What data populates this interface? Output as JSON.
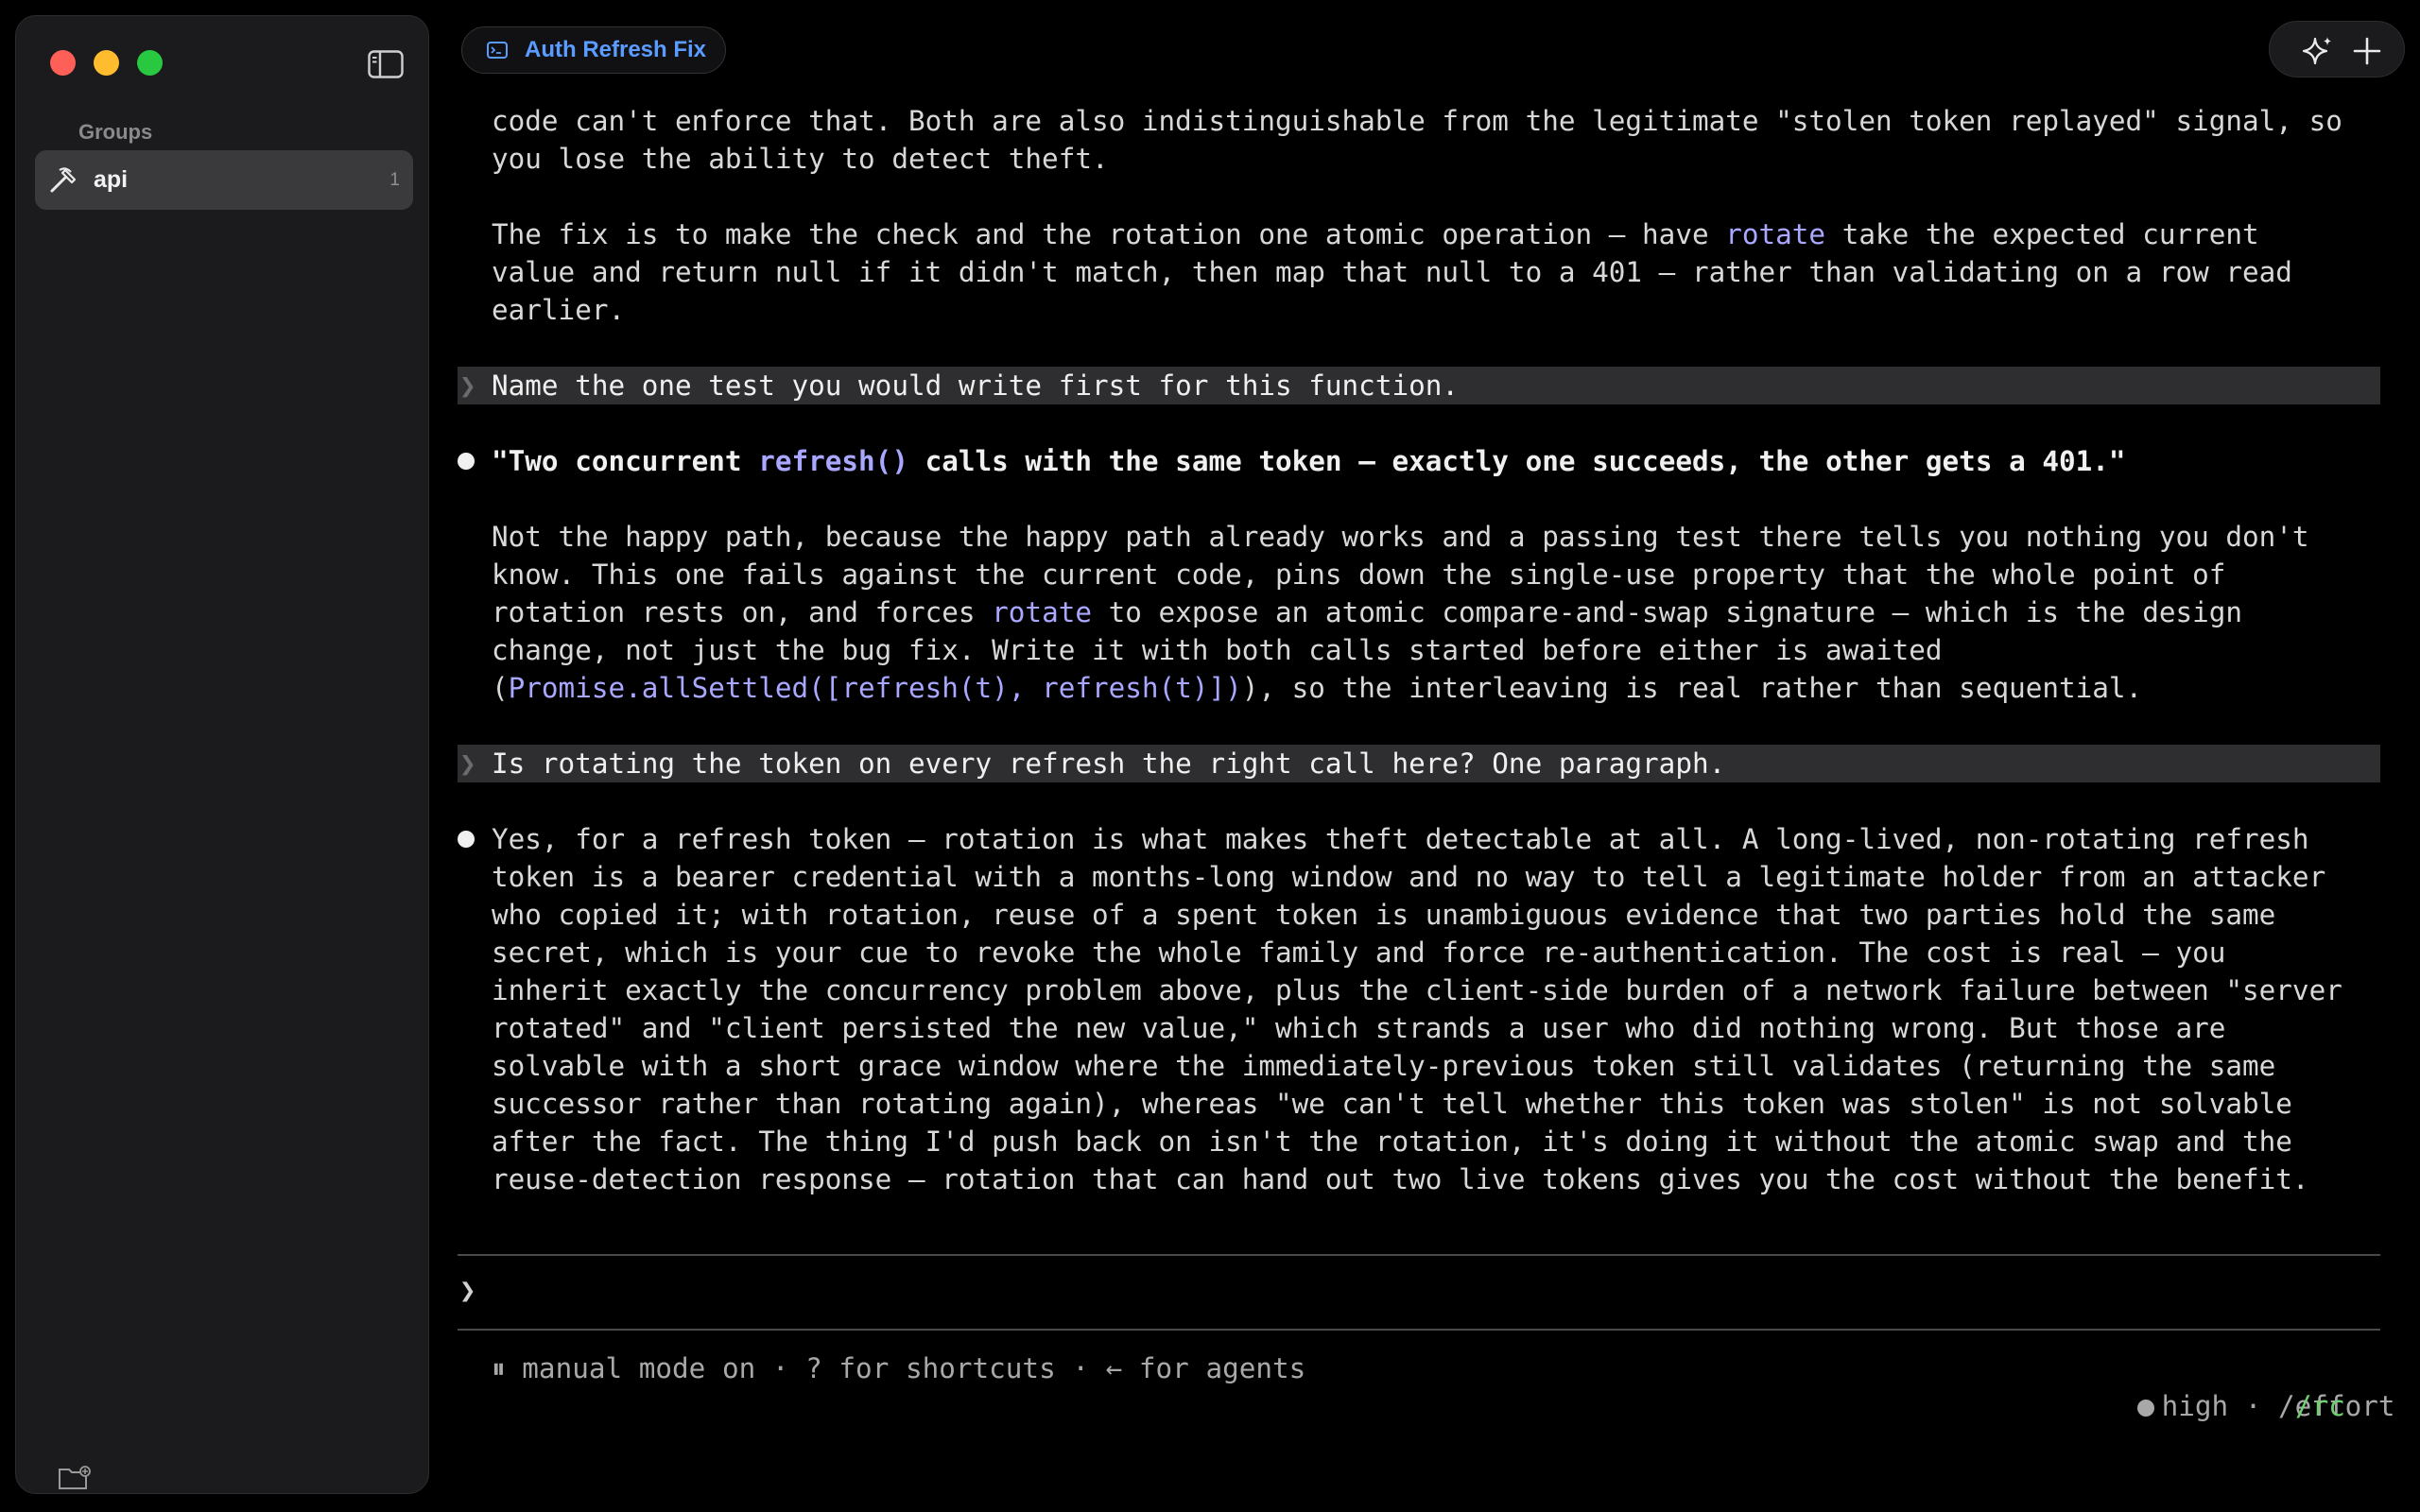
{
  "sidebar": {
    "groups_label": "Groups",
    "items": [
      {
        "label": "api",
        "count": "1",
        "icon": "hammer-icon"
      }
    ]
  },
  "tab": {
    "label": "Auth Refresh Fix",
    "icon": "terminal-icon",
    "accent": "#5a9cff"
  },
  "transcript": {
    "p1_line1": "code can't enforce that. Both are also indistinguishable from the legitimate \"stolen token replayed\" signal, so",
    "p1_line2": "you lose the ability to detect theft.",
    "p2_line1_a": "The fix is to make the check and the rotation one atomic operation — have ",
    "p2_line1_code": "rotate",
    "p2_line1_b": " take the expected current",
    "p2_line2": "value and return null if it didn't match, then map that null to a 401 — rather than validating on a row read",
    "p2_line3": "earlier.",
    "prompt1": "Name the one test you would write first for this function.",
    "answer1_a": "\"Two concurrent ",
    "answer1_code": "refresh()",
    "answer1_b": " calls with the same token — exactly one succeeds, the other gets a 401.\"",
    "p3_line1": "Not the happy path, because the happy path already works and a passing test there tells you nothing you don't",
    "p3_line2": "know. This one fails against the current code, pins down the single-use property that the whole point of",
    "p3_line3_a": "rotation rests on, and forces ",
    "p3_line3_code": "rotate",
    "p3_line3_b": " to expose an atomic compare-and-swap signature — which is the design",
    "p3_line4": "change, not just the bug fix. Write it with both calls started before either is awaited",
    "p3_line5_a": "(",
    "p3_line5_code": "Promise.allSettled([refresh(t), refresh(t)])",
    "p3_line5_b": "), so the interleaving is real rather than sequential.",
    "prompt2": "Is rotating the token on every refresh the right call here? One paragraph.",
    "answer2_lines": [
      "Yes, for a refresh token — rotation is what makes theft detectable at all. A long-lived, non-rotating refresh",
      "token is a bearer credential with a months-long window and no way to tell a legitimate holder from an attacker",
      "who copied it; with rotation, reuse of a spent token is unambiguous evidence that two parties hold the same",
      "secret, which is your cue to revoke the whole family and force re-authentication. The cost is real — you",
      "inherit exactly the concurrency problem above, plus the client-side burden of a network failure between \"server",
      "rotated\" and \"client persisted the new value,\" which strands a user who did nothing wrong. But those are",
      "solvable with a short grace window where the immediately-previous token still validates (returning the same",
      "successor rather than rotating again), whereas \"we can't tell whether this token was stolen\" is not solvable",
      "after the fact. The thing I'd push back on isn't the rotation, it's doing it without the atomic swap and the",
      "reuse-detection response — rotation that can hand out two live tokens gives you the cost without the benefit."
    ]
  },
  "input": {
    "prompt_char": "❯",
    "value": ""
  },
  "status": {
    "left": "⏸ manual mode on · ? for shortcuts · ← for agents",
    "right": "high · /effort",
    "rc": "/rc"
  },
  "colors": {
    "code": "#a9a7ff",
    "rc": "#6fcf6f",
    "prompt_bg": "#2e2e30"
  }
}
